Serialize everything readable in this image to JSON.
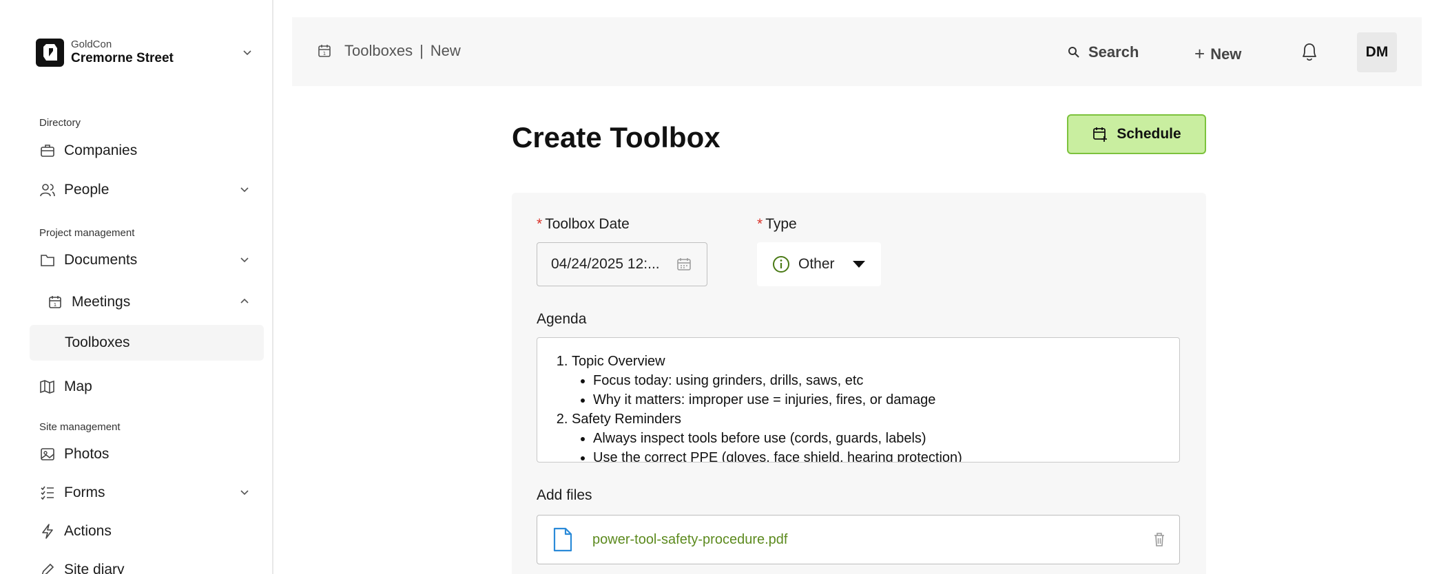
{
  "org": {
    "sub": "GoldCon",
    "name": "Cremorne Street"
  },
  "sidebar": {
    "sections": [
      "Directory",
      "Project management",
      "Site management"
    ],
    "items": [
      {
        "label": "Companies",
        "icon": "briefcase-icon"
      },
      {
        "label": "People",
        "icon": "people-icon"
      },
      {
        "label": "Documents",
        "icon": "folder-icon"
      },
      {
        "label": "Meetings",
        "icon": "calendar-icon"
      },
      {
        "label": "Toolboxes",
        "icon": ""
      },
      {
        "label": "Map",
        "icon": "map-icon"
      },
      {
        "label": "Photos",
        "icon": "photo-icon"
      },
      {
        "label": "Forms",
        "icon": "checklist-icon"
      },
      {
        "label": "Actions",
        "icon": "lightning-icon"
      },
      {
        "label": "Site diary",
        "icon": "pencil-icon"
      }
    ]
  },
  "header": {
    "crumb_parent": "Toolboxes",
    "crumb_sep": "|",
    "crumb_current": "New",
    "search_label": "Search",
    "new_label": "New",
    "avatar": "DM"
  },
  "main": {
    "title": "Create Toolbox",
    "schedule_label": "Schedule",
    "form": {
      "date_label": "Toolbox Date",
      "date_value": "04/24/2025 12:...",
      "type_label": "Type",
      "type_value": "Other",
      "required_mark": "*",
      "agenda_label": "Agenda",
      "agenda": {
        "item1": "Topic Overview",
        "item1_b1": "Focus today: using grinders, drills, saws, etc",
        "item1_b2": "Why it matters: improper use = injuries, fires, or damage",
        "item2": "Safety Reminders",
        "item2_b1": "Always inspect tools before use (cords, guards, labels)",
        "item2_b2": "Use the correct PPE (gloves, face shield, hearing protection)"
      },
      "files_label": "Add files",
      "file_name": "power-tool-safety-procedure.pdf"
    }
  },
  "colors": {
    "accent_green": "#c9eea0",
    "accent_border": "#7cc23c",
    "link_green": "#5c8a1e",
    "required_red": "#d9342b"
  }
}
